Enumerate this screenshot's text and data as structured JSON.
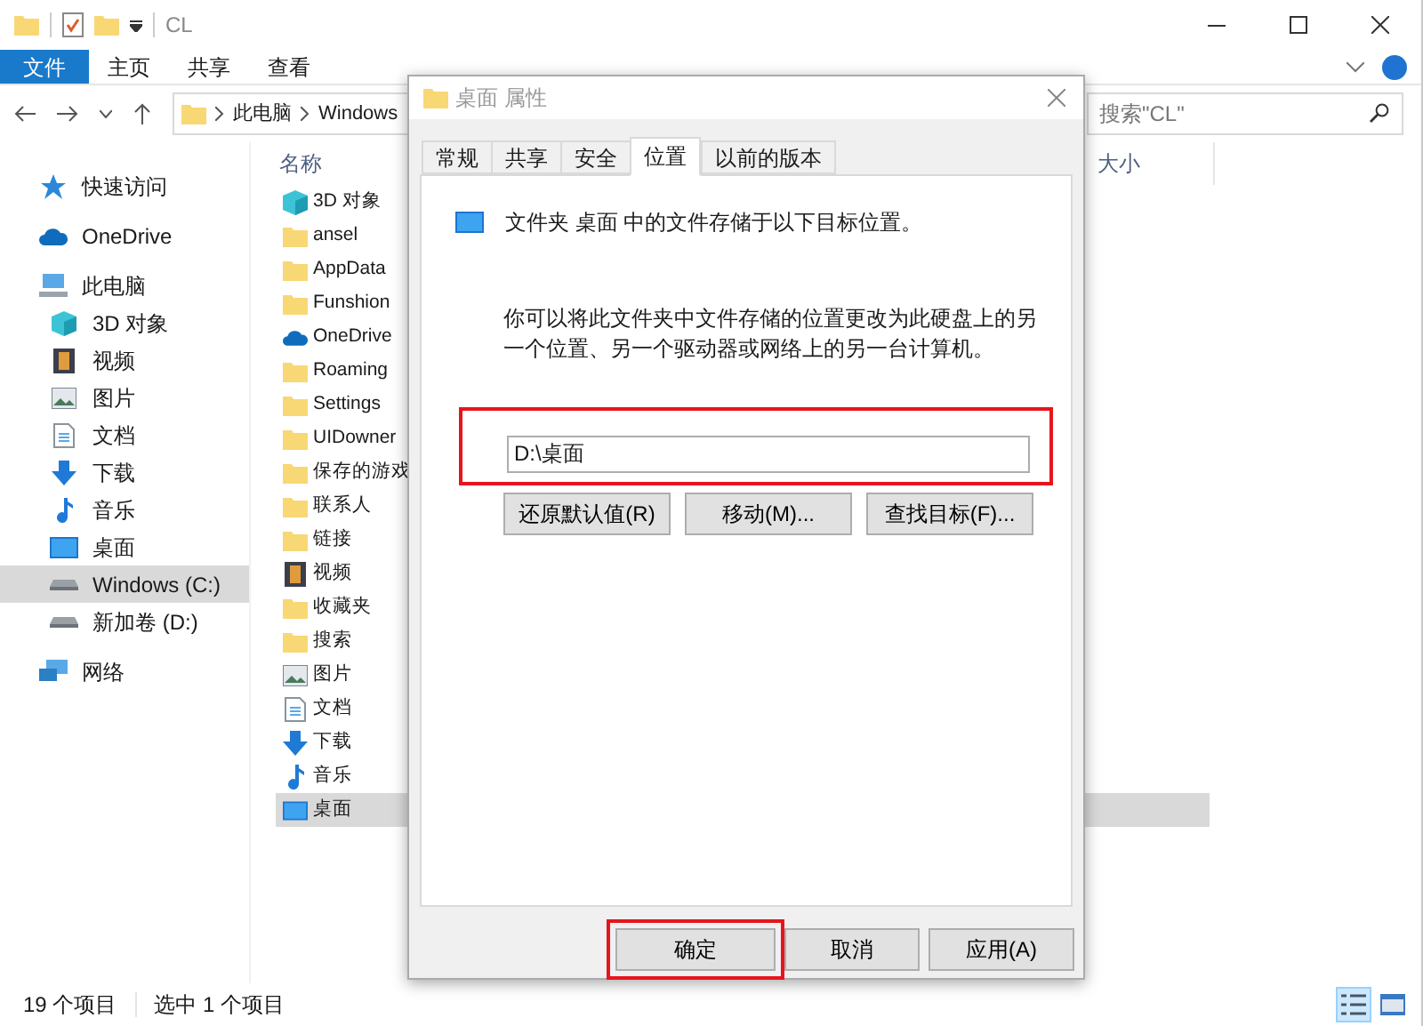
{
  "window": {
    "title": "CL"
  },
  "ribbon_tabs": [
    {
      "label": "文件",
      "selected": true
    },
    {
      "label": "主页",
      "selected": false
    },
    {
      "label": "共享",
      "selected": false
    },
    {
      "label": "查看",
      "selected": false
    }
  ],
  "address": {
    "crumbs": [
      "此电脑",
      "Windows"
    ]
  },
  "search": {
    "placeholder": "搜索\"CL\""
  },
  "sidebar": {
    "items": [
      {
        "label": "快速访问",
        "kind": "star",
        "selected": false
      },
      {
        "label": "OneDrive",
        "kind": "cloud",
        "selected": false
      },
      {
        "label": "此电脑",
        "kind": "pc",
        "selected": false,
        "children": [
          {
            "label": "3D 对象",
            "kind": "cube",
            "selected": false
          },
          {
            "label": "视频",
            "kind": "film",
            "selected": false
          },
          {
            "label": "图片",
            "kind": "image",
            "selected": false
          },
          {
            "label": "文档",
            "kind": "doc",
            "selected": false
          },
          {
            "label": "下载",
            "kind": "download",
            "selected": false
          },
          {
            "label": "音乐",
            "kind": "music",
            "selected": false
          },
          {
            "label": "桌面",
            "kind": "desktop",
            "selected": false
          },
          {
            "label": "Windows (C:)",
            "kind": "drive",
            "selected": true
          },
          {
            "label": "新加卷 (D:)",
            "kind": "drive",
            "selected": false
          }
        ]
      },
      {
        "label": "网络",
        "kind": "network",
        "selected": false
      }
    ]
  },
  "columns": [
    "名称",
    "大小"
  ],
  "files": [
    {
      "name": "3D 对象",
      "kind": "cube",
      "selected": false
    },
    {
      "name": "ansel",
      "kind": "folder",
      "selected": false
    },
    {
      "name": "AppData",
      "kind": "folder",
      "selected": false
    },
    {
      "name": "Funshion",
      "kind": "folder",
      "selected": false
    },
    {
      "name": "OneDrive",
      "kind": "cloud",
      "selected": false
    },
    {
      "name": "Roaming",
      "kind": "folder",
      "selected": false
    },
    {
      "name": "Settings",
      "kind": "folder",
      "selected": false
    },
    {
      "name": "UIDowner",
      "kind": "folder",
      "selected": false
    },
    {
      "name": "保存的游戏",
      "kind": "folder",
      "selected": false
    },
    {
      "name": "联系人",
      "kind": "folder",
      "selected": false
    },
    {
      "name": "链接",
      "kind": "folder",
      "selected": false
    },
    {
      "name": "视频",
      "kind": "film",
      "selected": false
    },
    {
      "name": "收藏夹",
      "kind": "folder",
      "selected": false
    },
    {
      "name": "搜索",
      "kind": "folder",
      "selected": false
    },
    {
      "name": "图片",
      "kind": "image",
      "selected": false
    },
    {
      "name": "文档",
      "kind": "doc",
      "selected": false
    },
    {
      "name": "下载",
      "kind": "download",
      "selected": false
    },
    {
      "name": "音乐",
      "kind": "music",
      "selected": false
    },
    {
      "name": "桌面",
      "kind": "desktop",
      "selected": true
    }
  ],
  "status_bar": {
    "count": "19 个项目",
    "selection": "选中 1 个项目"
  },
  "view_modes": [
    {
      "kind": "details",
      "selected": true
    },
    {
      "kind": "tiles",
      "selected": false
    }
  ],
  "dialog": {
    "title": "桌面 属性",
    "tabs": [
      {
        "label": "常规",
        "selected": false
      },
      {
        "label": "共享",
        "selected": false
      },
      {
        "label": "安全",
        "selected": false
      },
      {
        "label": "位置",
        "selected": true
      },
      {
        "label": "以前的版本",
        "selected": false
      }
    ],
    "message": "文件夹 桌面 中的文件存储于以下目标位置。",
    "description": "你可以将此文件夹中文件存储的位置更改为此硬盘上的另一个位置、另一个驱动器或网络上的另一台计算机。",
    "path": {
      "value": "D:\\桌面",
      "highlighted": true
    },
    "actions": [
      "还原默认值(R)",
      "移动(M)...",
      "查找目标(F)..."
    ],
    "footer_buttons": [
      {
        "label": "确定",
        "highlighted": true
      },
      {
        "label": "取消",
        "highlighted": false
      },
      {
        "label": "应用(A)",
        "highlighted": false
      }
    ]
  }
}
